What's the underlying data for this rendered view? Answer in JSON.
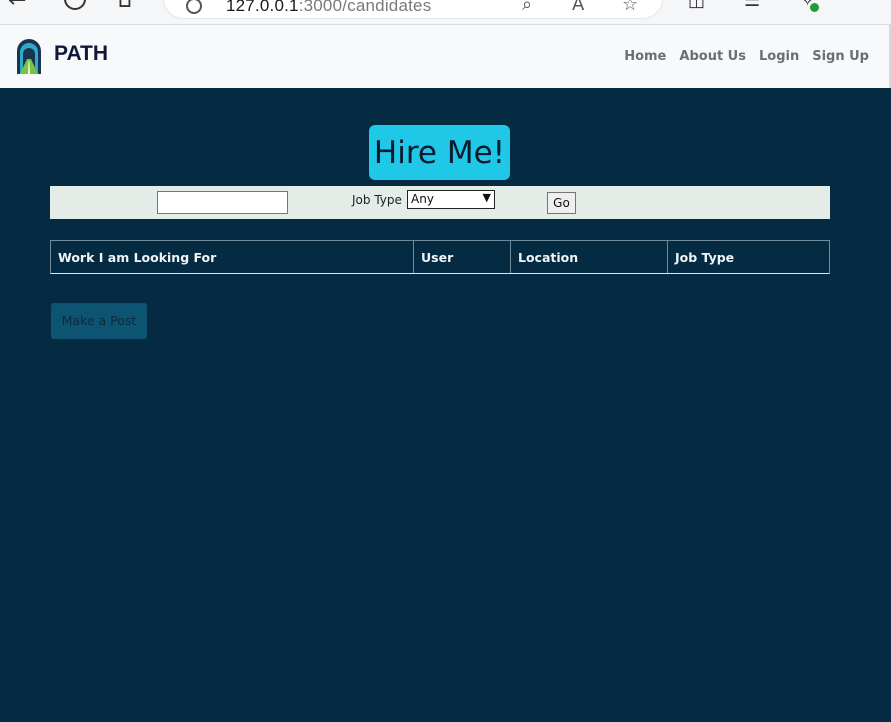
{
  "browser": {
    "url_host": "127.0.0.1",
    "url_rest": ":3000/candidates"
  },
  "navbar": {
    "brand": "PATH",
    "links": [
      "Home",
      "About Us",
      "Login",
      "Sign Up"
    ]
  },
  "title": "Hire Me!",
  "search": {
    "input_value": "",
    "job_type_label": "Job Type",
    "job_type_selected": "Any",
    "go_label": "Go"
  },
  "table": {
    "headers": [
      "Work I am Looking For",
      "User",
      "Location",
      "Job Type"
    ]
  },
  "post_button": "Make a Post",
  "colors": {
    "page_bg": "#042b42",
    "title_bg": "#1fc8e6",
    "searchbar_bg": "#e3ece6",
    "button_bg": "#0d5473"
  }
}
